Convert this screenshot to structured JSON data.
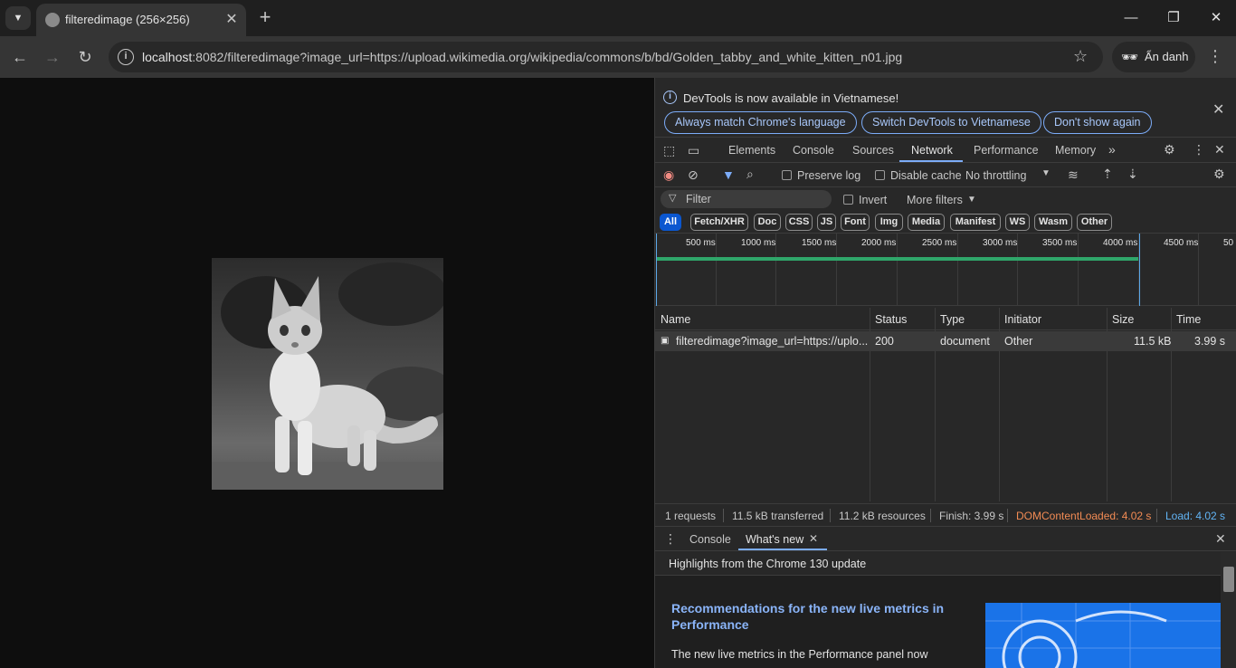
{
  "browser": {
    "tab_title": "filteredimage (256×256)",
    "url_host": "localhost",
    "url_rest": ":8082/filteredimage?image_url=https://upload.wikimedia.org/wikipedia/commons/b/bd/Golden_tabby_and_white_kitten_n01.jpg",
    "incognito_label": "Ẩn danh"
  },
  "devtools": {
    "infobar": {
      "message": "DevTools is now available in Vietnamese!",
      "btn_match": "Always match Chrome's language",
      "btn_switch": "Switch DevTools to Vietnamese",
      "btn_dont_show": "Don't show again"
    },
    "tabs": [
      "Elements",
      "Console",
      "Sources",
      "Network",
      "Performance",
      "Memory"
    ],
    "active_tab": "Network",
    "network": {
      "preserve_log": "Preserve log",
      "disable_cache": "Disable cache",
      "throttling": "No throttling",
      "filter_placeholder": "Filter",
      "invert": "Invert",
      "more_filters": "More filters",
      "type_filters": [
        "All",
        "Fetch/XHR",
        "Doc",
        "CSS",
        "JS",
        "Font",
        "Img",
        "Media",
        "Manifest",
        "WS",
        "Wasm",
        "Other"
      ],
      "timeline_ticks": [
        "500 ms",
        "1000 ms",
        "1500 ms",
        "2000 ms",
        "2500 ms",
        "3000 ms",
        "3500 ms",
        "4000 ms",
        "4500 ms",
        "50"
      ],
      "columns": [
        "Name",
        "Status",
        "Type",
        "Initiator",
        "Size",
        "Time"
      ],
      "rows": [
        {
          "name": "filteredimage?image_url=https://uplo...",
          "status": "200",
          "type": "document",
          "initiator": "Other",
          "size": "11.5 kB",
          "time": "3.99 s"
        }
      ],
      "summary": {
        "requests": "1 requests",
        "transferred": "11.5 kB transferred",
        "resources": "11.2 kB resources",
        "finish": "Finish: 3.99 s",
        "dcl": "DOMContentLoaded: 4.02 s",
        "load": "Load: 4.02 s"
      }
    },
    "drawer": {
      "tab_console": "Console",
      "tab_whats_new": "What's new",
      "highlights": "Highlights from the Chrome 130 update",
      "rec_title": "Recommendations for the new live metrics in Performance",
      "rec_body": "The new live metrics in the Performance panel now"
    }
  },
  "colors": {
    "accent": "#7cacf8",
    "dcl": "#f28b54",
    "load": "#62b4f5"
  }
}
